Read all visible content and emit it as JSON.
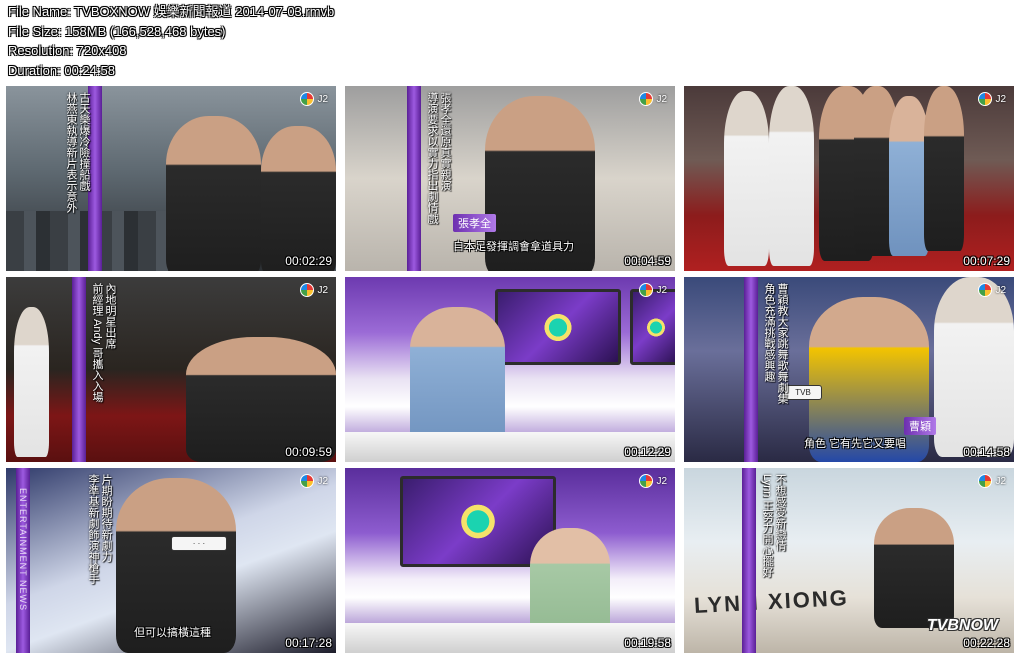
{
  "info": {
    "file_name": "File Name: TVBOXNOW 娛樂新聞報道 2014-07-03.rmvb",
    "file_size": "File Size: 158MB (166,528,468 bytes)",
    "resolution": "Resolution: 720x408",
    "duration": "Duration: 00:24:58"
  },
  "channel_logo": "J2",
  "thumbnails": [
    {
      "timestamp": "00:02:29",
      "caption_1": "林燕東執導新片表示意外",
      "caption_2": "古天樂爆冷險撞船戲"
    },
    {
      "timestamp": "00:04:59",
      "caption_1": "導演要求以實力指出劇情戲",
      "caption_2": "張孝全還原真實親演",
      "nameplate": "張孝全",
      "subtitle": "自本足發揮調會拿道具力"
    },
    {
      "timestamp": "00:07:29"
    },
    {
      "timestamp": "00:09:59",
      "caption_1": "前經理 Andy 哥攜入入場",
      "caption_2": "內地明星出席"
    },
    {
      "timestamp": "00:12:29"
    },
    {
      "timestamp": "00:14:58",
      "caption_1": "角色充滿挑戰感興趣",
      "caption_2": "曹穎教大家跳舞歌舞劇集",
      "nameplate": "曹穎",
      "subtitle": "角色 它有先它又要唱"
    },
    {
      "timestamp": "00:17:28",
      "caption_1": "李準基新劇飾演神槍手",
      "caption_2": "片期盼期待新劇力",
      "subtitle": "但可以搞橫這種",
      "sidebar_word": "ENTERTAINMENT NEWS"
    },
    {
      "timestamp": "00:19:58"
    },
    {
      "timestamp": "00:22:28",
      "caption_1": "Lynn 王努力開心擺好",
      "caption_2": "不想感受新戀情",
      "car_text": "LYNN XIONG",
      "watermark": "TVBNOW"
    }
  ]
}
